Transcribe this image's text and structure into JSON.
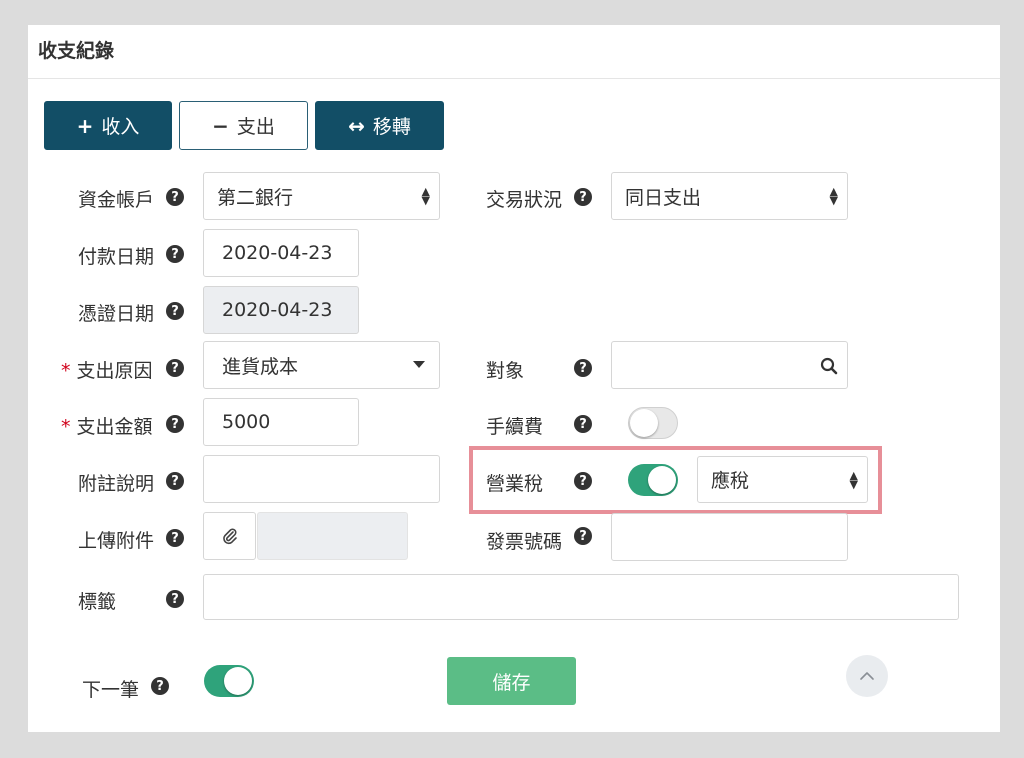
{
  "panel": {
    "title": "收支紀錄"
  },
  "buttons": {
    "income": {
      "icon": "+",
      "label": "收入"
    },
    "expense": {
      "icon": "−",
      "label": "支出"
    },
    "transfer": {
      "icon": "↔",
      "label": "移轉"
    }
  },
  "help_glyph": "?",
  "required_mark": "*",
  "form": {
    "account": {
      "label": "資金帳戶",
      "value": "第二銀行"
    },
    "status": {
      "label": "交易狀況",
      "value": "同日支出"
    },
    "pay_date": {
      "label": "付款日期",
      "value": "2020-04-23"
    },
    "voucher_date": {
      "label": "憑證日期",
      "value": "2020-04-23"
    },
    "reason": {
      "label": "支出原因",
      "value": "進貨成本"
    },
    "target": {
      "label": "對象",
      "value": ""
    },
    "amount": {
      "label": "支出金額",
      "value": "5000"
    },
    "fee": {
      "label": "手續費",
      "enabled": false
    },
    "note": {
      "label": "附註說明",
      "value": ""
    },
    "tax": {
      "label": "營業稅",
      "enabled": true,
      "value": "應稅"
    },
    "attachment": {
      "label": "上傳附件"
    },
    "invoice": {
      "label": "發票號碼",
      "value": ""
    },
    "tags": {
      "label": "標籤",
      "value": ""
    },
    "next": {
      "label": "下一筆",
      "enabled": true
    }
  },
  "save_label": "儲存",
  "colors": {
    "primary": "#124e66",
    "success": "#5bbd86",
    "toggle_on": "#2fa37b",
    "required": "#d0021b",
    "highlight": "#e78f98"
  }
}
